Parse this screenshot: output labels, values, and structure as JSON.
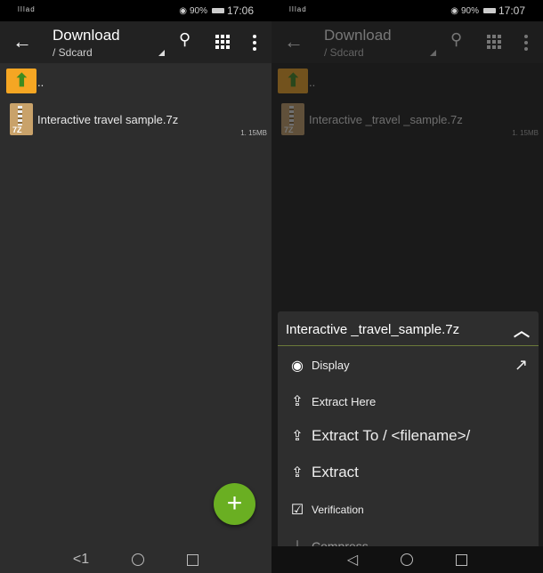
{
  "left": {
    "status": {
      "carrier": "lIlad",
      "battery": "90%",
      "time": "17:06"
    },
    "toolbar": {
      "title": "Download",
      "subtitle": "/ Sdcard"
    },
    "files": [
      {
        "name": "..",
        "type": "parent-folder",
        "size": ""
      },
      {
        "name": "Interactive  travel  sample.7z",
        "type": "7z-archive",
        "icon_label": "7Z",
        "size": "1. 15MB"
      }
    ],
    "fab": "+",
    "nav": {
      "back": "<1"
    }
  },
  "right": {
    "status": {
      "carrier": "lIlad",
      "battery": "90%",
      "time": "17:07"
    },
    "toolbar": {
      "title": "Download",
      "subtitle": "/ Sdcard"
    },
    "files": [
      {
        "name": "..",
        "type": "parent-folder",
        "size": ""
      },
      {
        "name": "Interactive _travel _sample.7z",
        "type": "7z-archive",
        "icon_label": "7Z",
        "size": "1. 15MB"
      }
    ],
    "sheet": {
      "title": "Interactive _travel_sample.7z",
      "items": [
        {
          "label": "Display",
          "icon": "eye-icon"
        },
        {
          "label": "Extract Here",
          "icon": "upload-icon"
        },
        {
          "label": "Extract To / <filename>/",
          "icon": "upload-icon"
        },
        {
          "label": "Extract",
          "icon": "upload-icon"
        },
        {
          "label": "Verification",
          "icon": "checkbox-icon"
        },
        {
          "label": "Compress",
          "icon": "download-icon"
        }
      ]
    }
  }
}
